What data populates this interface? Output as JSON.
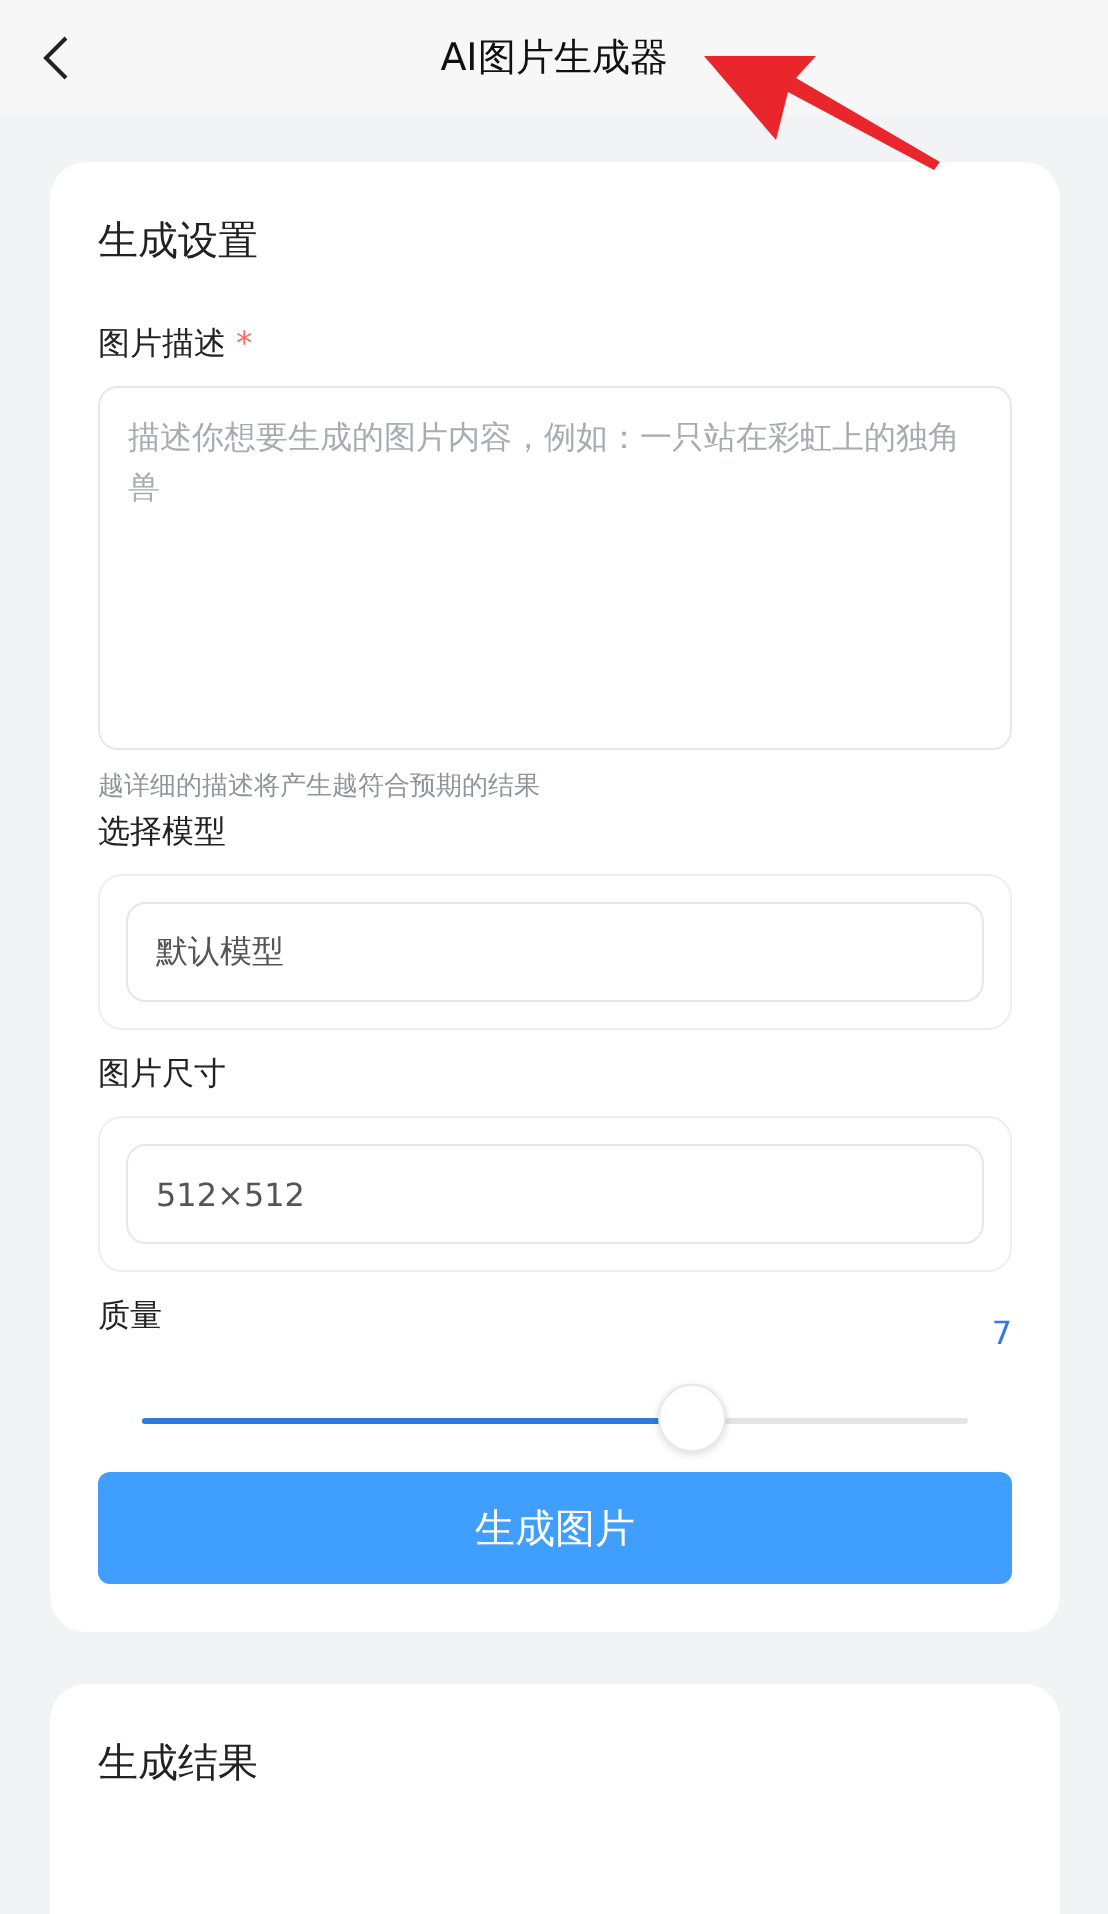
{
  "header": {
    "title": "AI图片生成器"
  },
  "settings": {
    "title": "生成设置",
    "description": {
      "label": "图片描述",
      "required_mark": "*",
      "placeholder": "描述你想要生成的图片内容，例如：一只站在彩虹上的独角兽",
      "hint": "越详细的描述将产生越符合预期的结果"
    },
    "model": {
      "label": "选择模型",
      "value": "默认模型"
    },
    "size": {
      "label": "图片尺寸",
      "value": "512×512"
    },
    "quality": {
      "label": "质量",
      "reading": "7",
      "level": 0.665
    },
    "submit": "生成图片"
  },
  "result": {
    "title": "生成结果"
  }
}
